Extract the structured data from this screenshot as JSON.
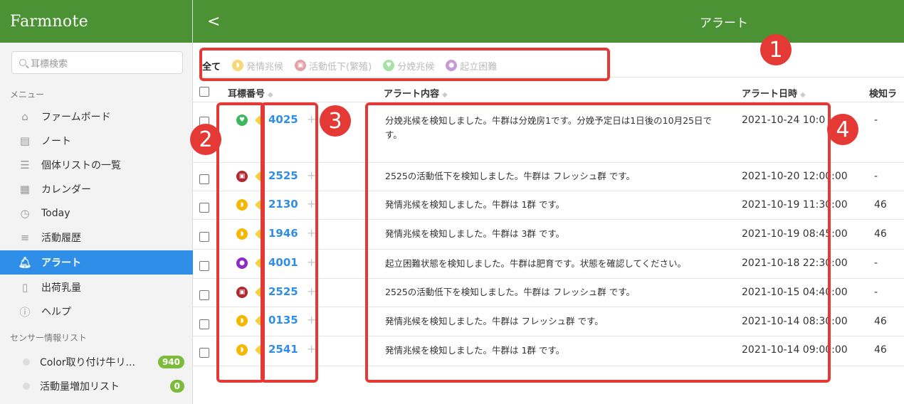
{
  "sidebar": {
    "logo": "Farmnote",
    "search_placeholder": "耳標検索",
    "menu_label": "メニュー",
    "items": [
      {
        "label": "ファームボード",
        "icon": "farm-icon"
      },
      {
        "label": "ノート",
        "icon": "note-icon"
      },
      {
        "label": "個体リストの一覧",
        "icon": "list-icon"
      },
      {
        "label": "カレンダー",
        "icon": "calendar-icon"
      },
      {
        "label": "Today",
        "icon": "clock-icon"
      },
      {
        "label": "活動履歴",
        "icon": "history-icon"
      },
      {
        "label": "アラート",
        "icon": "bell-icon",
        "active": true
      },
      {
        "label": "出荷乳量",
        "icon": "milk-bottle-icon"
      },
      {
        "label": "ヘルプ",
        "icon": "help-icon"
      }
    ],
    "sensor_label": "センサー情報リスト",
    "sensor_items": [
      {
        "label": "Color取り付け牛リ...",
        "count": "940"
      },
      {
        "label": "活動量増加リスト",
        "count": "0"
      }
    ]
  },
  "header": {
    "back": "<",
    "title": "アラート"
  },
  "tabs": [
    {
      "label": "全て",
      "active": true,
      "color": ""
    },
    {
      "label": "発情兆候",
      "color": "#f5d142"
    },
    {
      "label": "活動低下(繁殖)",
      "color": "#e89aa0"
    },
    {
      "label": "分娩兆候",
      "color": "#9fdc9f"
    },
    {
      "label": "起立困難",
      "color": "#c48fd6"
    }
  ],
  "table": {
    "headers": {
      "ear": "耳標番号",
      "content": "アラート内容",
      "datetime": "アラート日時",
      "detect": "検知ラ"
    },
    "rows": [
      {
        "type": "calving",
        "ear": "4025",
        "content": "分娩兆候を検知しました。牛群は分娩房1です。分娩予定日は1日後の10月25日です。",
        "datetime": "2021-10-24 10:0",
        "detect": "-"
      },
      {
        "type": "activity-drop",
        "ear": "2525",
        "content": "2525の活動低下を検知しました。牛群は フレッシュ群 です。",
        "datetime": "2021-10-20 12:00:00",
        "detect": "-"
      },
      {
        "type": "estrus",
        "ear": "2130",
        "content": "発情兆候を検知しました。牛群は 1群 です。",
        "datetime": "2021-10-19 11:30:00",
        "detect": "46"
      },
      {
        "type": "estrus",
        "ear": "1946",
        "content": "発情兆候を検知しました。牛群は 3群 です。",
        "datetime": "2021-10-19 08:45:00",
        "detect": "46"
      },
      {
        "type": "standing-difficulty",
        "ear": "4001",
        "content": "起立困難状態を検知しました。牛群は肥育です。状態を確認してください。",
        "datetime": "2021-10-18 22:30:00",
        "detect": "-"
      },
      {
        "type": "activity-drop",
        "ear": "2525",
        "content": "2525の活動低下を検知しました。牛群は フレッシュ群 です。",
        "datetime": "2021-10-15 04:40:00",
        "detect": "-"
      },
      {
        "type": "estrus",
        "ear": "0135",
        "content": "発情兆候を検知しました。牛群は フレッシュ群 です。",
        "datetime": "2021-10-14 08:30:00",
        "detect": "46"
      },
      {
        "type": "estrus",
        "ear": "2541",
        "content": "発情兆候を検知しました。牛群は 1群 です。",
        "datetime": "2021-10-14 09:00:00",
        "detect": "46"
      }
    ]
  },
  "colors": {
    "header_green": "#4a9233",
    "active_blue": "#2f8ee8",
    "annotation_red": "#e53935",
    "estrus": "#f5b800",
    "calving": "#3cb95c",
    "activity_drop": "#b1282f",
    "standing_difficulty": "#8e2bc4"
  },
  "annotations": [
    "1",
    "2",
    "3",
    "4"
  ]
}
